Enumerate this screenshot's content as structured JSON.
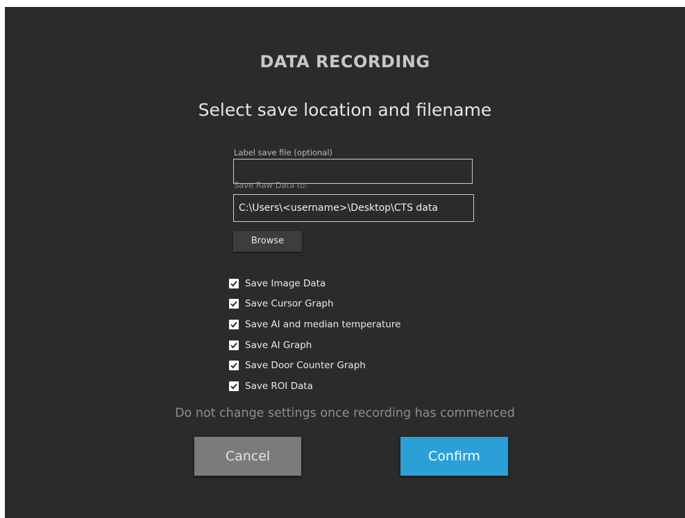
{
  "dialog": {
    "title": "DATA RECORDING",
    "subtitle": "Select save location and filename"
  },
  "form": {
    "label_file": {
      "label": "Label save file (optional)",
      "value": ""
    },
    "save_path": {
      "label": "Save Raw Data to:",
      "value": "C:\\Users\\<username>\\Desktop\\CTS data"
    },
    "browse_label": "Browse"
  },
  "options": [
    {
      "label": "Save Image Data",
      "checked": true
    },
    {
      "label": "Save Cursor Graph",
      "checked": true
    },
    {
      "label": "Save AI and median temperature",
      "checked": true
    },
    {
      "label": "Save AI Graph",
      "checked": true
    },
    {
      "label": "Save Door Counter Graph",
      "checked": true
    },
    {
      "label": "Save ROI Data",
      "checked": true
    }
  ],
  "warning": "Do not change settings once recording has commenced",
  "buttons": {
    "cancel": "Cancel",
    "confirm": "Confirm"
  },
  "colors": {
    "background": "#2b2b2b",
    "confirm": "#2aa0d6",
    "cancel": "#7b7b7b"
  }
}
